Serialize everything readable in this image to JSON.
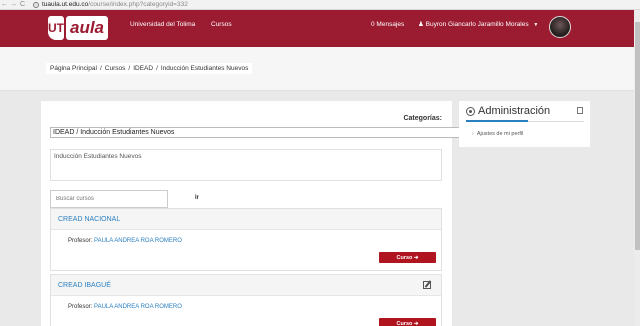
{
  "browser": {
    "back": "←",
    "forward": "→",
    "reload": "C",
    "url_host": "tuaula.ut.edu.co",
    "url_path": "/course/index.php?categoryid=332"
  },
  "header": {
    "logo_mark": "UT",
    "logo_word": "aula",
    "nav": [
      "Universidad del Tolima",
      "Cursos"
    ],
    "messages": "0 Mensajes",
    "user_name": "Buyron Giancarlo Jaramillo Morales"
  },
  "breadcrumb": [
    "Página Principal",
    "Cursos",
    "IDEAD",
    "Inducción Estudiantes Nuevos"
  ],
  "main": {
    "categories_label": "Categorías:",
    "category_value": "IDEAD / Inducción Estudiantes Nuevos",
    "description": "Inducción Estudiantes Nuevos",
    "search_placeholder": "Buscar cursos",
    "search_button": "Ir"
  },
  "courses": [
    {
      "title": "CREAD NACIONAL",
      "teacher_label": "Profesor:",
      "teacher_name": "PAULA ANDREA ROA ROMERO",
      "button": "Curso ➔"
    },
    {
      "title": "CREAD IBAGUÉ",
      "teacher_label": "Profesor:",
      "teacher_name": "PAULA ANDREA ROA ROMERO",
      "button": "Curso ➔"
    }
  ],
  "admin": {
    "title": "Administración",
    "items": [
      "Ajustes de mi perfil"
    ]
  },
  "colors": {
    "brand": "#9b1b30",
    "button": "#b0141f",
    "link": "#2a7fc1"
  }
}
